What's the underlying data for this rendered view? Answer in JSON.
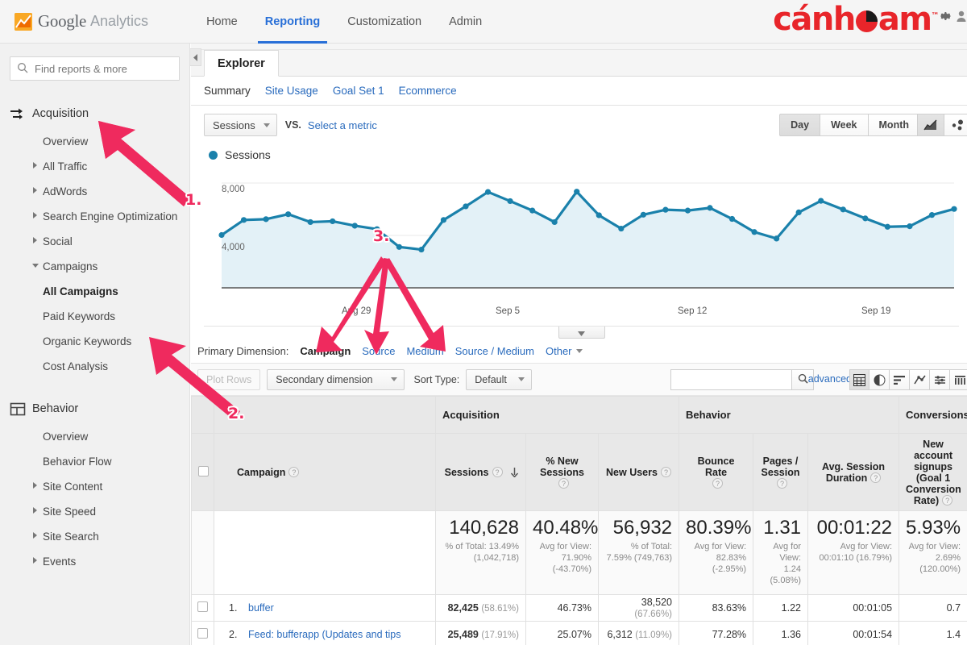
{
  "topbar": {
    "product_primary": "Google",
    "product_secondary": "Analytics",
    "logo_icon": "google-analytics-logo",
    "nav": [
      {
        "label": "Home",
        "active": false
      },
      {
        "label": "Reporting",
        "active": true
      },
      {
        "label": "Customization",
        "active": false
      },
      {
        "label": "Admin",
        "active": false
      }
    ],
    "brand": {
      "part1": "c",
      "part2": "ánh",
      "part3": "am",
      "tm": "™",
      "pie_icon": "pie-chart-letter-icon",
      "gear_icon": "gear-icon",
      "person_icon": "person-icon"
    }
  },
  "sidebar": {
    "search_placeholder": "Find reports & more",
    "search_icon": "search-icon",
    "sections": [
      {
        "title": "Acquisition",
        "icon": "acquisition-arrows-icon",
        "items": [
          {
            "label": "Overview",
            "caret": "none",
            "bold": false,
            "indent": "sub"
          },
          {
            "label": "All Traffic",
            "caret": "closed",
            "bold": false,
            "indent": "caret"
          },
          {
            "label": "AdWords",
            "caret": "closed",
            "bold": false,
            "indent": "caret"
          },
          {
            "label": "Search Engine Optimization",
            "caret": "closed",
            "bold": false,
            "indent": "caret"
          },
          {
            "label": "Social",
            "caret": "closed",
            "bold": false,
            "indent": "caret"
          },
          {
            "label": "Campaigns",
            "caret": "open",
            "bold": false,
            "indent": "caret"
          },
          {
            "label": "All Campaigns",
            "caret": "none",
            "bold": true,
            "indent": "sub2"
          },
          {
            "label": "Paid Keywords",
            "caret": "none",
            "bold": false,
            "indent": "sub2"
          },
          {
            "label": "Organic Keywords",
            "caret": "none",
            "bold": false,
            "indent": "sub2"
          },
          {
            "label": "Cost Analysis",
            "caret": "none",
            "bold": false,
            "indent": "sub2"
          }
        ]
      },
      {
        "title": "Behavior",
        "icon": "behavior-layout-icon",
        "items": [
          {
            "label": "Overview",
            "caret": "none",
            "bold": false,
            "indent": "sub"
          },
          {
            "label": "Behavior Flow",
            "caret": "none",
            "bold": false,
            "indent": "sub"
          },
          {
            "label": "Site Content",
            "caret": "closed",
            "bold": false,
            "indent": "caret"
          },
          {
            "label": "Site Speed",
            "caret": "closed",
            "bold": false,
            "indent": "caret"
          },
          {
            "label": "Site Search",
            "caret": "closed",
            "bold": false,
            "indent": "caret"
          },
          {
            "label": "Events",
            "caret": "closed",
            "bold": false,
            "indent": "caret"
          }
        ]
      }
    ]
  },
  "content": {
    "tab": "Explorer",
    "subtabs": [
      {
        "label": "Summary",
        "active": true
      },
      {
        "label": "Site Usage",
        "active": false
      },
      {
        "label": "Goal Set 1",
        "active": false
      },
      {
        "label": "Ecommerce",
        "active": false
      }
    ],
    "metric_select": "Sessions",
    "vs_label": "VS.",
    "select_metric_link": "Select a metric",
    "granularity": [
      {
        "label": "Day",
        "active": true
      },
      {
        "label": "Week",
        "active": false
      },
      {
        "label": "Month",
        "active": false
      }
    ],
    "chart_type_icons": [
      {
        "name": "line-chart-icon",
        "active": true
      },
      {
        "name": "motion-chart-icon",
        "active": false
      }
    ]
  },
  "chart_data": {
    "type": "line",
    "title": "Sessions",
    "legend": [
      "Sessions"
    ],
    "legend_position": "top-left",
    "legend_color": "#1a81ab",
    "xlabel": "",
    "ylabel": "",
    "ylim": [
      0,
      8000
    ],
    "ytick_labels": [
      "8,000",
      "4,000"
    ],
    "yticks": [
      8000,
      4000
    ],
    "grid": true,
    "xtick_labels": [
      "Aug 29",
      "Sep 5",
      "Sep 12",
      "Sep 19"
    ],
    "xtick_indices": [
      6,
      13,
      20,
      27
    ],
    "series": [
      {
        "name": "Sessions",
        "color": "#1a81ab",
        "fill": "#e3f1f7",
        "values": [
          4030,
          5180,
          5240,
          5620,
          5020,
          5080,
          4740,
          4480,
          3120,
          2920,
          5180,
          6220,
          7320,
          6620,
          5900,
          5020,
          7340,
          5540,
          4520,
          5580,
          5960,
          5900,
          6100,
          5260,
          4260,
          3760,
          5760,
          6640,
          5980,
          5300,
          4660,
          4700,
          5560,
          6020
        ]
      }
    ]
  },
  "primary_dimension": {
    "label": "Primary Dimension:",
    "options": [
      {
        "label": "Campaign",
        "selected": true
      },
      {
        "label": "Source",
        "selected": false
      },
      {
        "label": "Medium",
        "selected": false
      },
      {
        "label": "Source / Medium",
        "selected": false
      },
      {
        "label": "Other",
        "selected": false,
        "dropdown": true
      }
    ]
  },
  "table_toolbar": {
    "plot_rows": "Plot Rows",
    "secondary_dimension": "Secondary dimension",
    "sort_type_label": "Sort Type:",
    "sort_type_value": "Default",
    "search_value": "",
    "search_icon": "search-icon",
    "advanced": "advanced",
    "view_icons": [
      {
        "name": "table-view-icon",
        "active": true
      },
      {
        "name": "pie-view-icon",
        "active": false
      },
      {
        "name": "performance-view-icon",
        "active": false
      },
      {
        "name": "comparison-view-icon",
        "active": false
      },
      {
        "name": "term-cloud-view-icon",
        "active": false
      },
      {
        "name": "pivot-view-icon",
        "active": false
      }
    ]
  },
  "table": {
    "group_headers": [
      {
        "label": "Acquisition",
        "span": 3
      },
      {
        "label": "Behavior",
        "span": 3
      },
      {
        "label": "Conversions",
        "span": 1
      }
    ],
    "dimension_header": "Campaign",
    "columns": [
      {
        "label": "Sessions",
        "help": true,
        "sorted": "desc",
        "align": "right"
      },
      {
        "label": "% New Sessions",
        "help": true,
        "align": "center"
      },
      {
        "label": "New Users",
        "help": true,
        "align": "right"
      },
      {
        "label": "Bounce Rate",
        "help": true,
        "align": "center"
      },
      {
        "label": "Pages / Session",
        "help": true,
        "align": "center"
      },
      {
        "label": "Avg. Session Duration",
        "help": true,
        "align": "right"
      },
      {
        "label": "New account signups (Goal 1 Conversion Rate)",
        "help": true,
        "align": "center"
      }
    ],
    "summary_row": [
      {
        "big": "140,628",
        "sub": "% of Total: 13.49% (1,042,718)"
      },
      {
        "big": "40.48%",
        "sub": "Avg for View: 71.90% (-43.70%)"
      },
      {
        "big": "56,932",
        "sub": "% of Total: 7.59% (749,763)"
      },
      {
        "big": "80.39%",
        "sub": "Avg for View: 82.83% (-2.95%)"
      },
      {
        "big": "1.31",
        "sub": "Avg for View: 1.24 (5.08%)"
      },
      {
        "big": "00:01:22",
        "sub": "Avg for View: 00:01:10 (16.79%)"
      },
      {
        "big": "5.93%",
        "sub": "Avg for View: 2.69% (120.00%)"
      }
    ],
    "rows": [
      {
        "index": "1.",
        "name": "buffer",
        "sessions": "82,425",
        "sessions_pct": "(58.61%)",
        "new_sessions": "46.73%",
        "new_users": "38,520",
        "new_users_pct": "(67.66%)",
        "bounce_rate": "83.63%",
        "pages_session": "1.22",
        "avg_duration": "00:01:05",
        "conversion": "0.7"
      },
      {
        "index": "2.",
        "name": "Feed: bufferapp (Updates and tips",
        "sessions": "25,489",
        "sessions_pct": "(17.91%)",
        "new_sessions": "25.07%",
        "new_users": "6,312",
        "new_users_pct": "(11.09%)",
        "bounce_rate": "77.28%",
        "pages_session": "1.36",
        "avg_duration": "00:01:54",
        "conversion": "1.4"
      }
    ]
  },
  "annotations": [
    {
      "id": "1.",
      "target": "Acquisition"
    },
    {
      "id": "2.",
      "target": "All Campaigns"
    },
    {
      "id": "3.",
      "target": "chart dip"
    }
  ]
}
